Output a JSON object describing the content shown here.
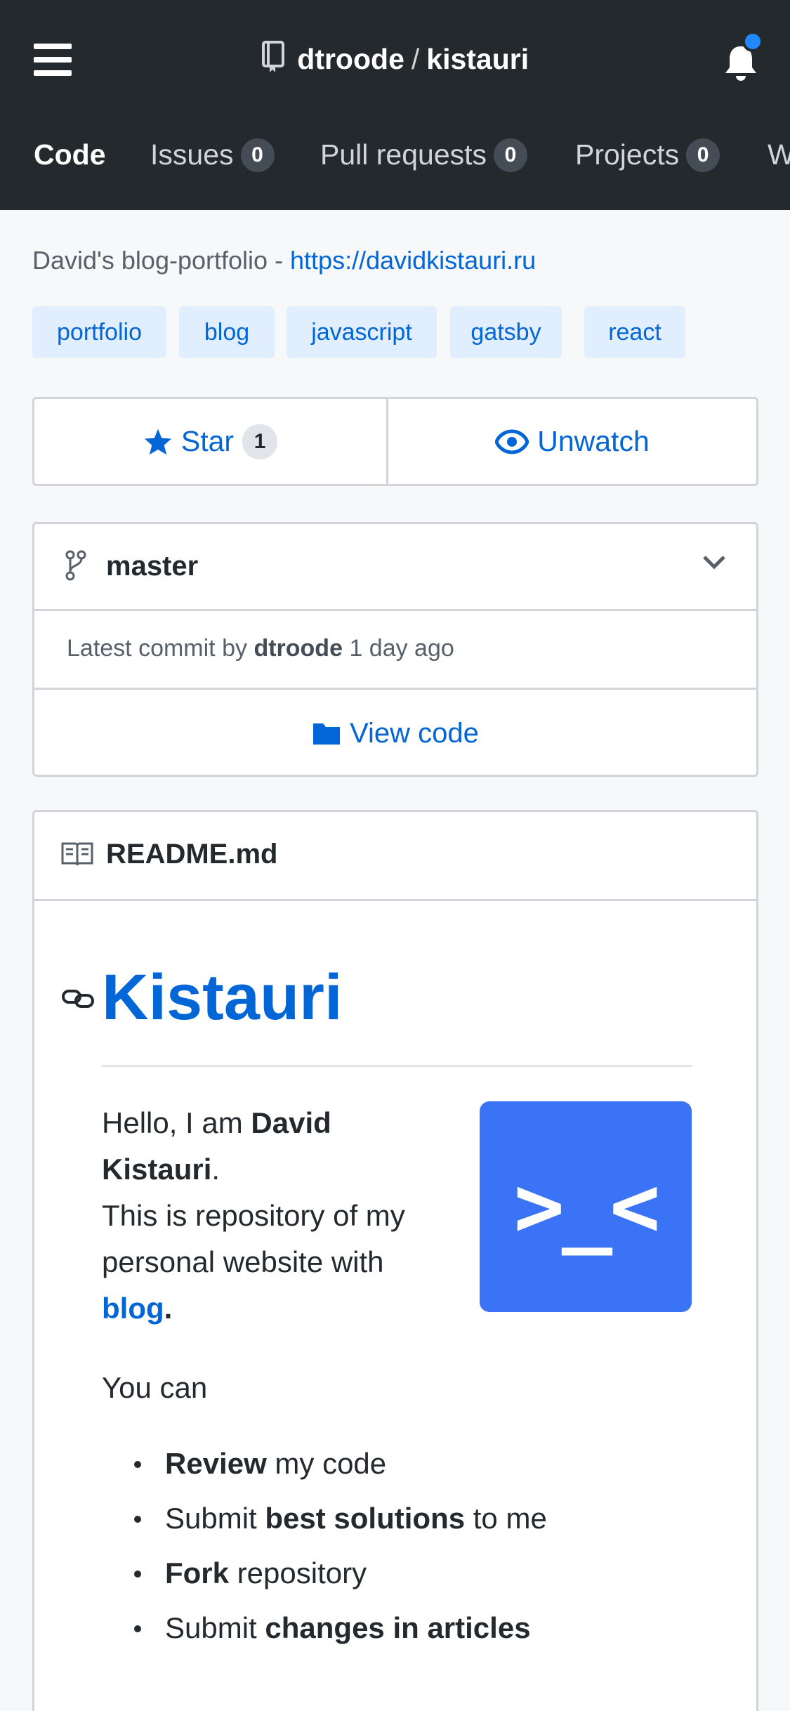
{
  "header": {
    "owner": "dtroode",
    "separator": "/",
    "repo": "kistauri",
    "notification_dot_color": "#2188ff"
  },
  "tabs": [
    {
      "label": "Code",
      "active": true
    },
    {
      "label": "Issues",
      "count": "0"
    },
    {
      "label": "Pull requests",
      "count": "0"
    },
    {
      "label": "Projects",
      "count": "0"
    },
    {
      "label": "W"
    }
  ],
  "description": {
    "text": "David's blog-portfolio - ",
    "link": "https://davidkistauri.ru"
  },
  "topics": [
    "portfolio",
    "blog",
    "javascript",
    "gatsby",
    "react"
  ],
  "actions": {
    "star_label": "Star",
    "star_count": "1",
    "watch_label": "Unwatch"
  },
  "branch": {
    "name": "master",
    "commit_prefix": "Latest commit by",
    "commit_author": "dtroode",
    "commit_time": "1 day ago",
    "view_code": "View code"
  },
  "readme": {
    "filename": "README.md",
    "heading": "Kistauri",
    "intro_prefix": "Hello, I am ",
    "intro_name": "David Kistauri",
    "intro_suffix": ".",
    "intro_line2": "This is repository of my personal website with ",
    "intro_link": "blog",
    "intro_end": ".",
    "logo_text": ">_<",
    "you_can": "You can",
    "bullets": [
      {
        "bold_first": true,
        "a": "Review",
        "b": " my code"
      },
      {
        "bold_first": false,
        "a": "Submit ",
        "b": "best solutions",
        "c": " to me"
      },
      {
        "bold_first": true,
        "a": "Fork",
        "b": " repository"
      },
      {
        "bold_first": false,
        "a": "Submit ",
        "b": "changes in articles"
      }
    ]
  },
  "colors": {
    "header_bg": "#24292e",
    "link": "#0366d6",
    "topic_bg": "#e1eefd",
    "logo_bg": "#3b73f6"
  }
}
